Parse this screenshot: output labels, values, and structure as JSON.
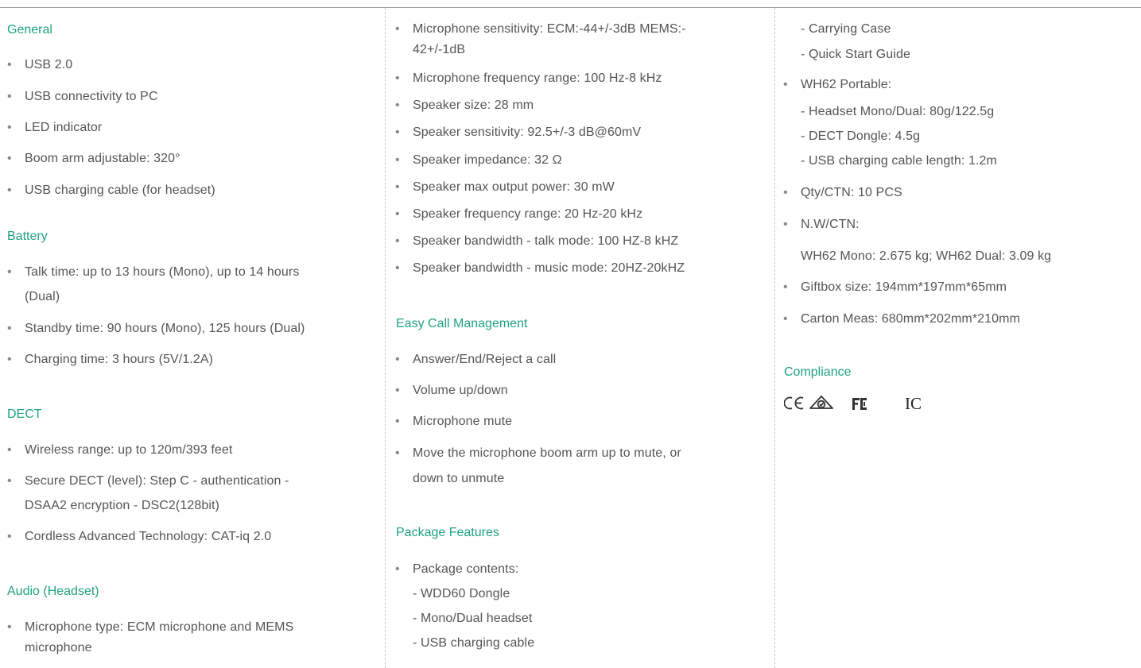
{
  "col1": {
    "general": {
      "title": "General",
      "items": [
        "USB 2.0",
        "USB connectivity to PC",
        "LED indicator",
        "Boom arm adjustable: 320°",
        "USB charging cable (for headset)"
      ]
    },
    "battery": {
      "title": "Battery",
      "talk_l1": "Talk time: up to 13 hours (Mono), up to 14 hours",
      "talk_l2": "(Dual)",
      "standby": "Standby time: 90 hours (Mono), 125 hours (Dual)",
      "charging": "Charging time: 3 hours (5V/1.2A)"
    },
    "dect": {
      "title": "DECT",
      "range": "Wireless range: up to 120m/393 feet",
      "secure_l1": "Secure DECT (level): Step C - authentication -",
      "secure_l2": "DSAA2 encryption - DSC2(128bit)",
      "cat": "Cordless Advanced Technology: CAT-iq 2.0"
    },
    "audio": {
      "title": "Audio (Headset)",
      "mic_l1": "Microphone type: ECM microphone and MEMS",
      "mic_l2": "microphone"
    }
  },
  "col2": {
    "sens_l1": "Microphone sensitivity: ECM:-44+/-3dB MEMS:-",
    "sens_l2": "42+/-1dB",
    "audio_items": [
      "Microphone frequency range: 100 Hz-8 kHz",
      "Speaker size: 28 mm",
      "Speaker sensitivity: 92.5+/-3 dB@60mV",
      "Speaker impedance: 32 Ω",
      "Speaker max output power: 30 mW",
      "Speaker frequency range: 20 Hz-20 kHz",
      "Speaker bandwidth - talk mode: 100 HZ-8 kHZ",
      "Speaker bandwidth - music mode: 20HZ-20kHZ"
    ],
    "call": {
      "title": "Easy Call Management",
      "items": [
        "Answer/End/Reject a call",
        "Volume up/down",
        "Microphone mute"
      ],
      "boom_l1": "Move the microphone boom arm up to mute, or",
      "boom_l2": "down to unmute"
    },
    "package": {
      "title": "Package Features",
      "contents": "Package contents:",
      "subs": [
        "- WDD60 Dongle",
        "- Mono/Dual headset",
        "- USB charging cable"
      ]
    }
  },
  "col3": {
    "pkg_subs": [
      "- Carrying Case",
      "- Quick Start Guide"
    ],
    "wh62": "WH62 Portable:",
    "wh62_subs": [
      "- Headset Mono/Dual: 80g/122.5g",
      "- DECT Dongle: 4.5g",
      "- USB charging cable length: 1.2m"
    ],
    "qty": "Qty/CTN: 10 PCS",
    "nw": "N.W/CTN:",
    "nw_value": "WH62 Mono: 2.675 kg; WH62 Dual: 3.09 kg",
    "giftbox": "Giftbox size: 194mm*197mm*65mm",
    "carton": "Carton Meas: 680mm*202mm*210mm",
    "compliance": {
      "title": "Compliance",
      "marks": [
        "CE",
        "RCM",
        "FC",
        "IC"
      ]
    }
  },
  "colors": {
    "accent": "#1ea37e",
    "text": "#555555",
    "bullet": "#888888"
  }
}
